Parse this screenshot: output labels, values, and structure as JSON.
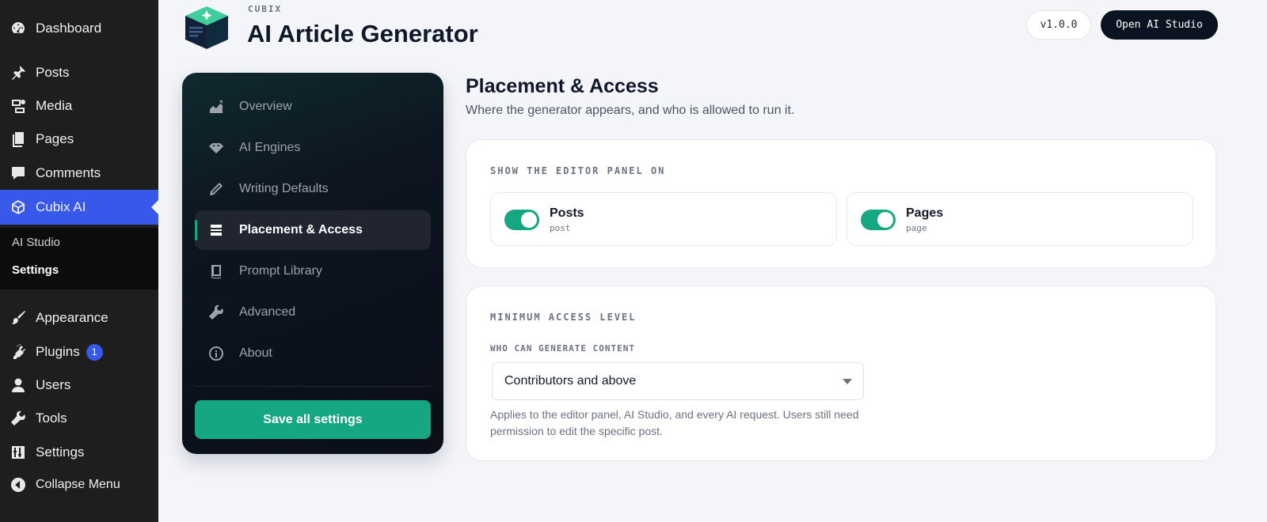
{
  "wp_menu": {
    "dashboard": "Dashboard",
    "posts": "Posts",
    "media": "Media",
    "pages": "Pages",
    "comments": "Comments",
    "cubix": "Cubix AI",
    "submenu": {
      "ai_studio": "AI Studio",
      "settings": "Settings"
    },
    "appearance": "Appearance",
    "plugins": "Plugins",
    "plugins_badge": "1",
    "users": "Users",
    "tools": "Tools",
    "settings": "Settings",
    "collapse": "Collapse Menu"
  },
  "header": {
    "brand": "CUBIX",
    "title": "AI Article Generator",
    "version": "v1.0.0",
    "open_studio": "Open AI Studio"
  },
  "nav": {
    "items": [
      {
        "label": "Overview",
        "icon": "chart-icon"
      },
      {
        "label": "AI Engines",
        "icon": "gem-icon"
      },
      {
        "label": "Writing Defaults",
        "icon": "pencil-icon"
      },
      {
        "label": "Placement & Access",
        "icon": "layers-icon",
        "active": true
      },
      {
        "label": "Prompt Library",
        "icon": "book-icon"
      },
      {
        "label": "Advanced",
        "icon": "wrench-icon"
      },
      {
        "label": "About",
        "icon": "info-icon"
      }
    ],
    "save": "Save all settings"
  },
  "section": {
    "title": "Placement & Access",
    "subtitle": "Where the generator appears, and who is allowed to run it."
  },
  "editor_panel": {
    "label": "SHOW THE EDITOR PANEL ON",
    "toggles": [
      {
        "label": "Posts",
        "code": "post",
        "on": true
      },
      {
        "label": "Pages",
        "code": "page",
        "on": true
      }
    ]
  },
  "access": {
    "label": "MINIMUM ACCESS LEVEL",
    "field_label": "WHO CAN GENERATE CONTENT",
    "selected": "Contributors and above",
    "help": "Applies to the editor panel, AI Studio, and every AI request. Users still need permission to edit the specific post."
  },
  "colors": {
    "wp_active": "#3858e9",
    "accent": "#15a683",
    "nav_bg": "#0a0f19"
  }
}
